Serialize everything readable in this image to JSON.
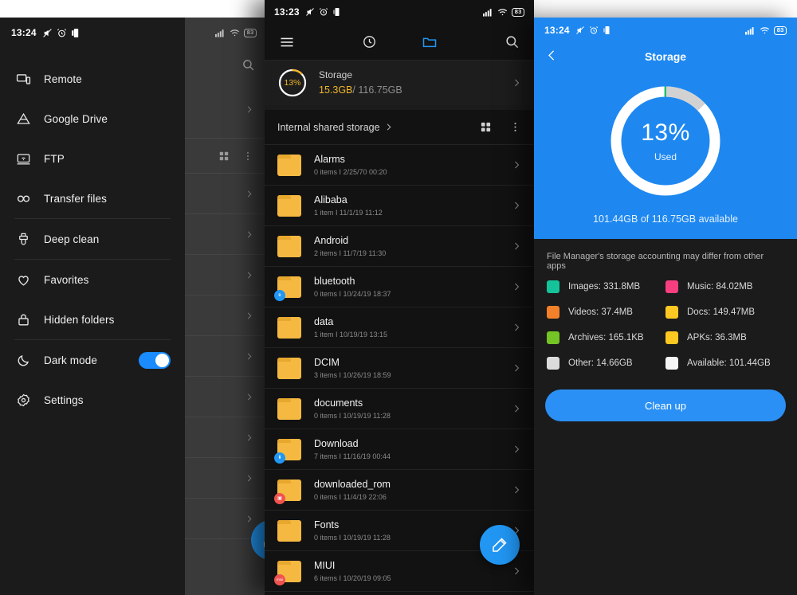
{
  "drawer": {
    "statusbar": {
      "time": "13:24",
      "icons": [
        "mute-icon",
        "alarm-icon",
        "vibrate-icon"
      ]
    },
    "items": [
      {
        "label": "Remote",
        "icon": "remote-screen-icon",
        "sep_after": false
      },
      {
        "label": "Google Drive",
        "icon": "google-drive-icon",
        "sep_after": false
      },
      {
        "label": "FTP",
        "icon": "ftp-icon",
        "sep_after": false
      },
      {
        "label": "Transfer files",
        "icon": "transfer-link-icon",
        "sep_after": true
      },
      {
        "label": "Deep clean",
        "icon": "brush-icon",
        "sep_after": true
      },
      {
        "label": "Favorites",
        "icon": "heart-icon",
        "sep_after": false
      },
      {
        "label": "Hidden folders",
        "icon": "lock-icon",
        "sep_after": true
      },
      {
        "label": "Dark mode",
        "icon": "moon-icon",
        "toggle": true,
        "toggle_on": true,
        "sep_after": false
      },
      {
        "label": "Settings",
        "icon": "gear-icon",
        "sep_after": false
      }
    ]
  },
  "dim_panel": {
    "statusbar": {
      "icons": [
        "signal-icon",
        "wifi-icon"
      ],
      "battery": "83"
    },
    "row_count": 9
  },
  "files": {
    "statusbar": {
      "time": "13:23",
      "icons": [
        "mute-icon",
        "alarm-icon",
        "vibrate-icon"
      ],
      "battery": "83"
    },
    "nav": [
      {
        "name": "menu-icon",
        "label": "Menu"
      },
      {
        "name": "recent-clock-icon",
        "label": "Recent"
      },
      {
        "name": "folder-icon",
        "label": "Files",
        "active": true
      },
      {
        "name": "search-icon",
        "label": "Search"
      }
    ],
    "storage_card": {
      "percent": "13%",
      "percent_value": 13,
      "title": "Storage",
      "used": "15.3GB",
      "total": "/ 116.75GB",
      "chevron": "chevron-right-icon"
    },
    "path": {
      "label": "Internal shared storage",
      "chevron": "chevron-right-icon",
      "grid_icon": "grid-view-icon",
      "more_icon": "more-vertical-icon"
    },
    "rows": [
      {
        "name": "Alarms",
        "meta": "0 items  I  2/25/70 00:20",
        "badge": ""
      },
      {
        "name": "Alibaba",
        "meta": "1 item  I  11/1/19 11:12",
        "badge": ""
      },
      {
        "name": "Android",
        "meta": "2 items  I  11/7/19 11:30",
        "badge": ""
      },
      {
        "name": "bluetooth",
        "meta": "0 items  I  10/24/19 18:37",
        "badge": "bt",
        "badge_glyph": "ʙ"
      },
      {
        "name": "data",
        "meta": "1 item  I  10/19/19 13:15",
        "badge": ""
      },
      {
        "name": "DCIM",
        "meta": "3 items  I  10/26/19 18:59",
        "badge": ""
      },
      {
        "name": "documents",
        "meta": "0 items  I  10/19/19 11:28",
        "badge": ""
      },
      {
        "name": "Download",
        "meta": "7 items  I  11/16/19 00:44",
        "badge": "dl",
        "badge_glyph": "⬇"
      },
      {
        "name": "downloaded_rom",
        "meta": "0 items  I  11/4/19 22:06",
        "badge": "rom",
        "badge_glyph": "▣"
      },
      {
        "name": "Fonts",
        "meta": "0 items  I  10/19/19 11:28",
        "badge": ""
      },
      {
        "name": "MIUI",
        "meta": "6 items  I  10/20/19 09:05",
        "badge": "miui",
        "badge_glyph": "miui"
      }
    ],
    "fab": {
      "icon": "brush-fab-icon",
      "label": "Deep clean"
    }
  },
  "storage_view": {
    "statusbar": {
      "time": "13:24",
      "icons": [
        "mute-icon",
        "alarm-icon",
        "vibrate-icon"
      ],
      "battery": "83"
    },
    "back_icon": "back-chevron-icon",
    "title": "Storage",
    "donut": {
      "percent": "13%",
      "caption": "Used",
      "percent_value": 13
    },
    "available_text": "101.44GB of 116.75GB available",
    "note": "File Manager's storage accounting may differ from other apps",
    "legend": [
      {
        "label": "Images: 331.8MB",
        "color": "#15c39a"
      },
      {
        "label": "Music: 84.02MB",
        "color": "#f73f7f"
      },
      {
        "label": "Videos: 37.4MB",
        "color": "#f2812a"
      },
      {
        "label": "Docs: 149.47MB",
        "color": "#fcc821"
      },
      {
        "label": "Archives: 165.1KB",
        "color": "#74c425"
      },
      {
        "label": "APKs: 36.3MB",
        "color": "#fcc821"
      },
      {
        "label": "Other: 14.66GB",
        "color": "#dcdcdc"
      },
      {
        "label": "Available: 101.44GB",
        "color": "#f5f5f5"
      }
    ],
    "cleanup_button": "Clean up"
  },
  "colors": {
    "accent_blue": "#2196f3",
    "hero_blue": "#1e88f0",
    "amber": "#f0b429",
    "folder": "#f5b942",
    "dark_bg": "#1b1b1b",
    "files_bg": "#121212"
  }
}
